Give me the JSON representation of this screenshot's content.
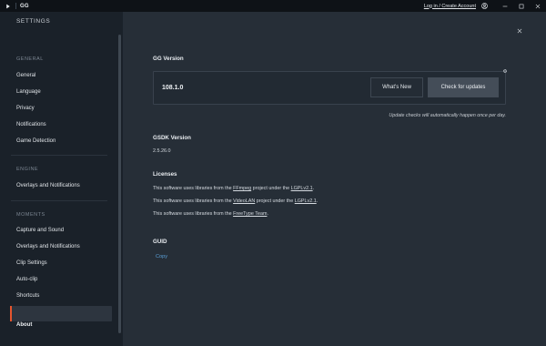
{
  "titlebar": {
    "app_title": "GG",
    "account_link": "Log in / Create Account"
  },
  "sidebar": {
    "heading": "SETTINGS",
    "groups": [
      {
        "label": "GENERAL",
        "items": [
          "General",
          "Language",
          "Privacy",
          "Notifications",
          "Game Detection"
        ]
      },
      {
        "label": "ENGINE",
        "items": [
          "Overlays and Notifications"
        ]
      },
      {
        "label": "MOMENTS",
        "items": [
          "Capture and Sound",
          "Overlays and Notifications",
          "Clip Settings",
          "Auto-clip",
          "Shortcuts"
        ]
      }
    ],
    "active_item": "About"
  },
  "gg_version": {
    "title": "GG Version",
    "version": "108.1.0",
    "whats_new_label": "What's New",
    "check_updates_label": "Check for updates",
    "note": "Update checks will automatically happen once per day."
  },
  "gsdk": {
    "title": "GSDK Version",
    "version": "2.5.26.0"
  },
  "licenses": {
    "title": "Licenses",
    "lines": [
      {
        "prefix": "This software uses libraries from the ",
        "project": "FFmpeg",
        "middle": " project under the ",
        "license": "LGPLv2.1",
        "suffix": "."
      },
      {
        "prefix": "This software uses libraries from the ",
        "project": "VideoLAN",
        "middle": " project under the ",
        "license": "LGPLv2.1",
        "suffix": "."
      },
      {
        "prefix": "This software uses libraries from the ",
        "project": "FreeType Team",
        "middle": "",
        "license": "",
        "suffix": "."
      }
    ]
  },
  "guid": {
    "title": "GUID",
    "copy_label": "Copy"
  },
  "colors": {
    "accent": "#e5552e",
    "link": "#5a9fd6"
  }
}
